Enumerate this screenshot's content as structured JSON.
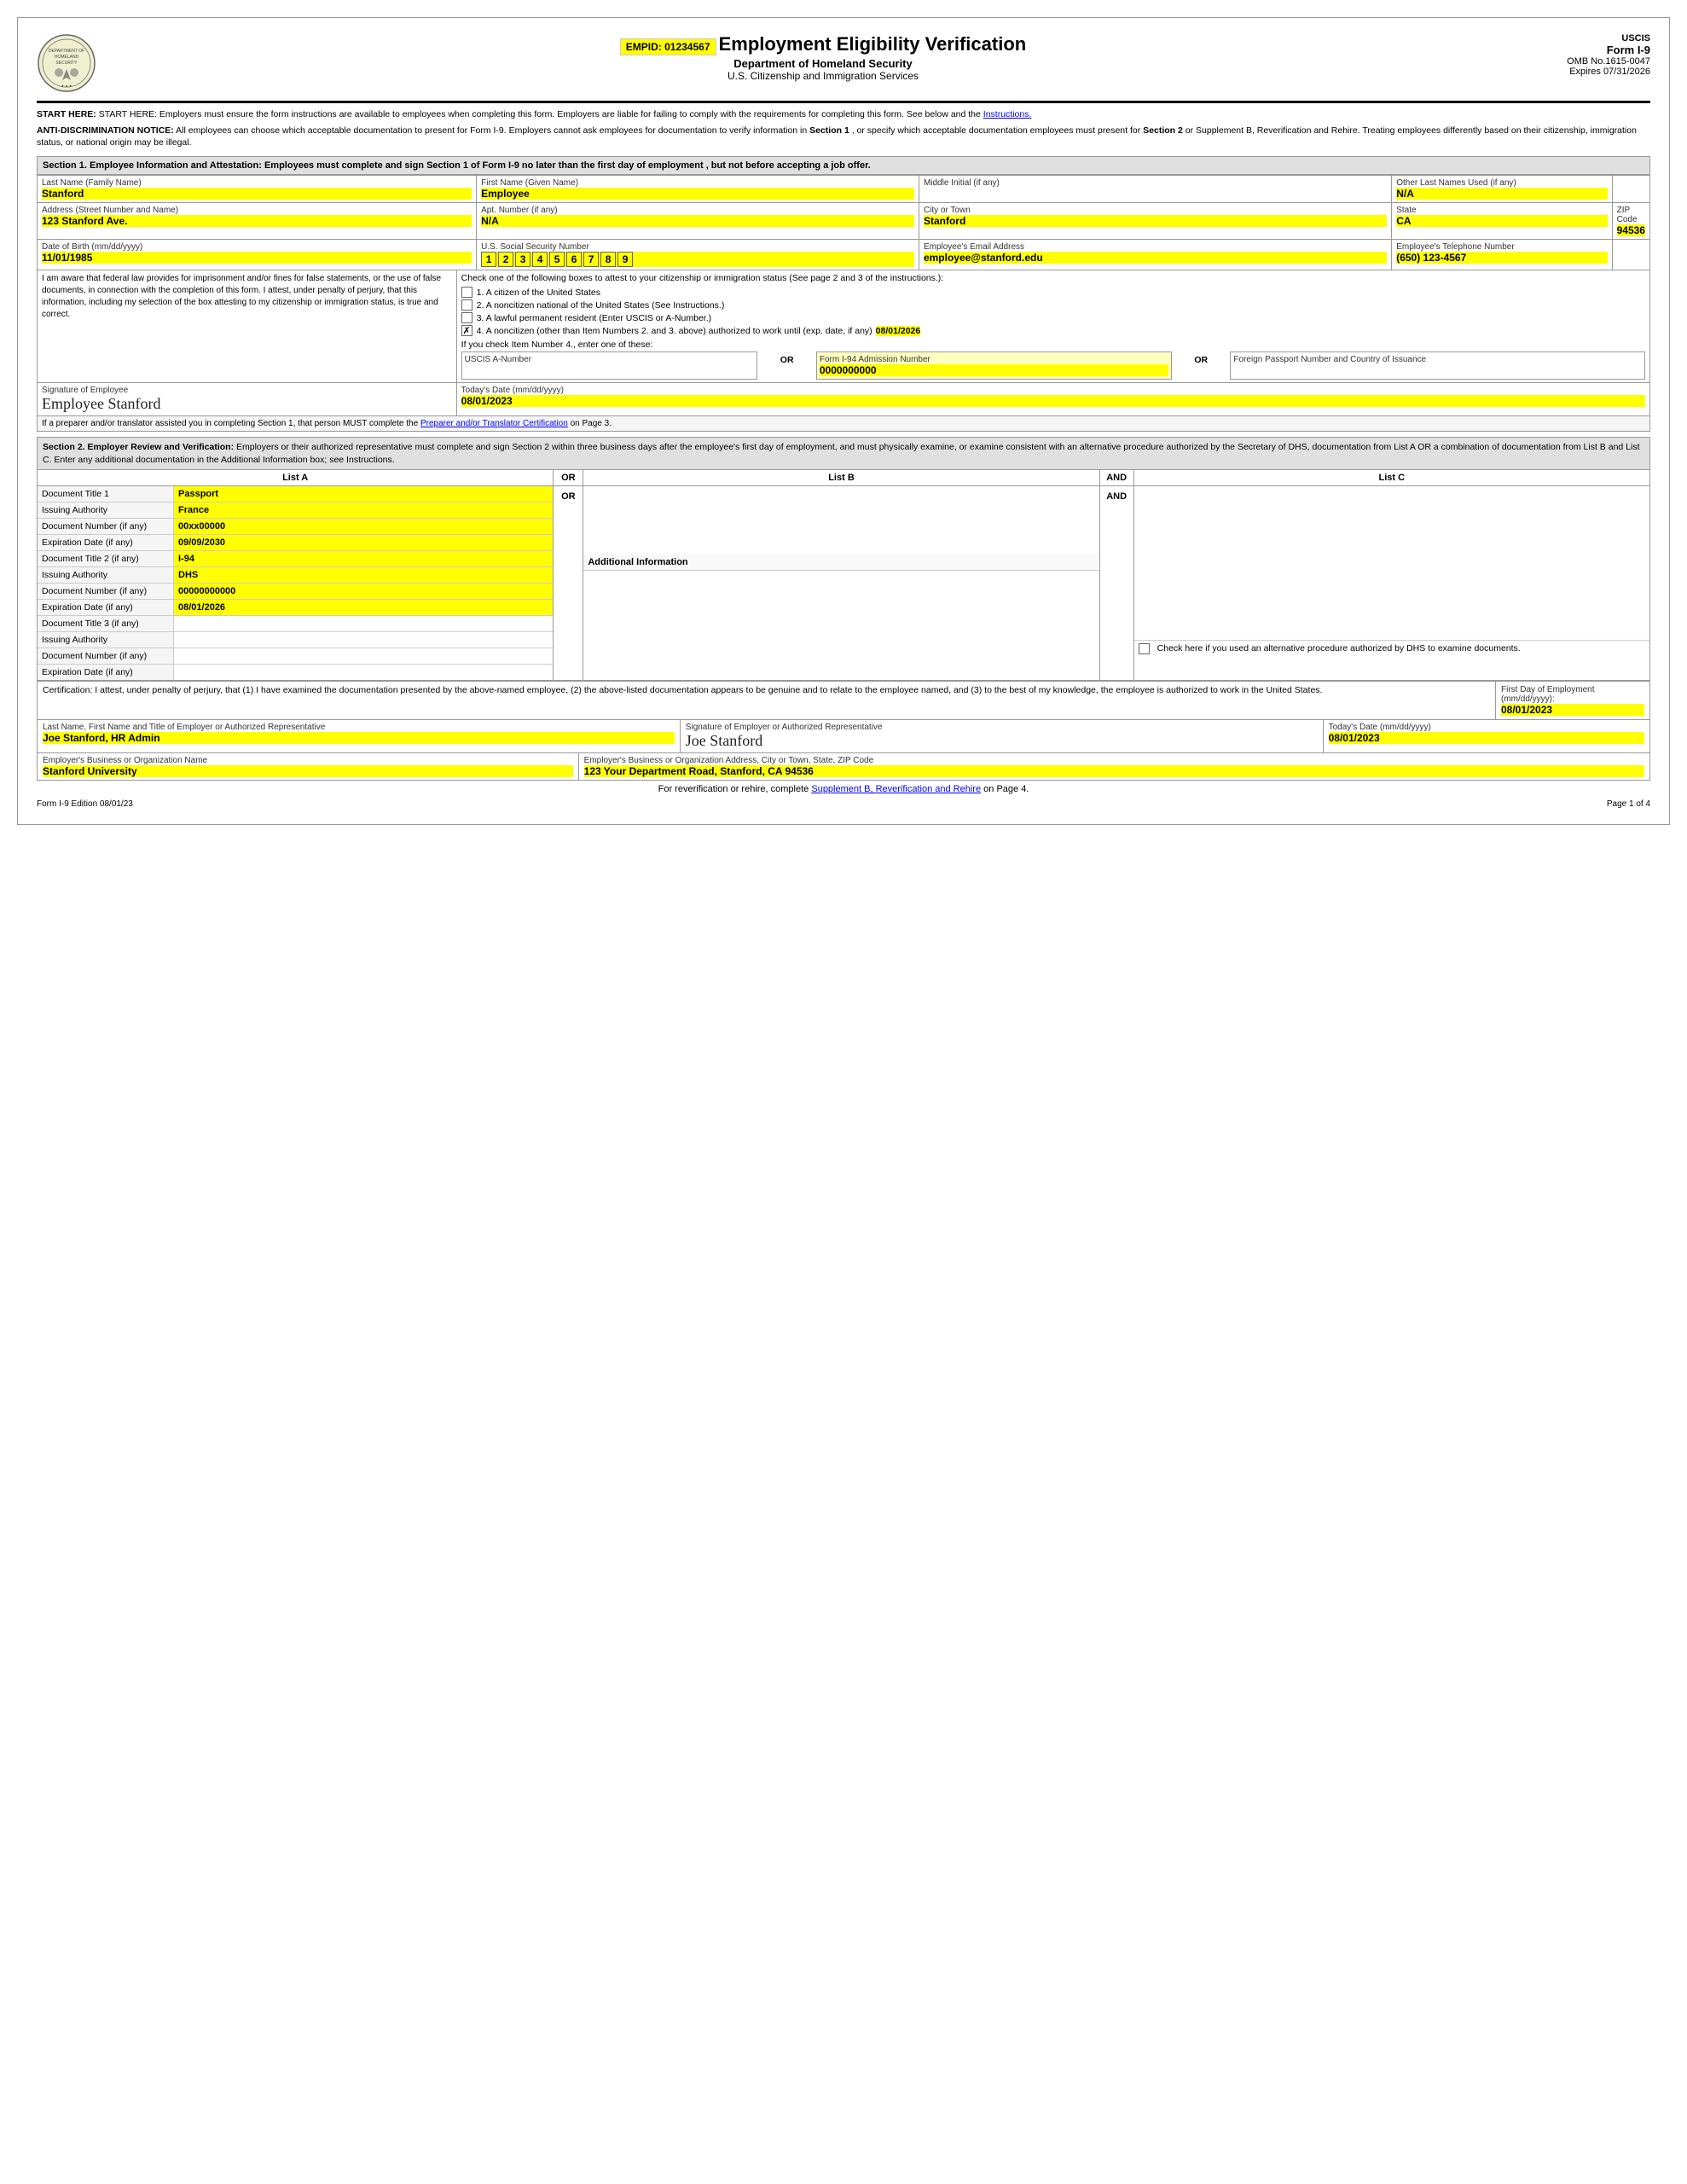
{
  "header": {
    "empid_label": "EMPID: 01234567",
    "title": "Employment Eligibility Verification",
    "dept": "Department of Homeland Security",
    "agency": "U.S. Citizenship and Immigration Services",
    "form_name": "USCIS",
    "form_id": "Form I-9",
    "omb": "OMB No.1615-0047",
    "expires": "Expires 07/31/2026"
  },
  "notices": {
    "start_here": "START HERE:  Employers must ensure the form instructions are available to employees when completing this form. Employers are liable for failing to comply with the requirements for completing this form. See below and the",
    "instructions_link": "Instructions.",
    "anti_disc": "ANTI-DISCRIMINATION NOTICE:",
    "anti_disc_body": " All employees can choose which acceptable documentation to present for Form I-9. Employers cannot ask employees for documentation to verify information in ",
    "section1_bold": "Section 1",
    "anti_disc_body2": ", or specify which acceptable documentation employees must present for ",
    "section2_bold": "Section 2",
    "anti_disc_body3": " or Supplement B, Reverification and Rehire. Treating employees differently based on their citizenship, immigration status, or national origin may be illegal."
  },
  "section1": {
    "header": "Section 1. Employee Information and Attestation:",
    "header_body": " Employees must complete and sign Section 1 of Form I-9 no later than the ",
    "header_bold": "first day of employment",
    "header_body2": ", but not before accepting a job offer.",
    "last_name_label": "Last Name (Family Name)",
    "last_name": "Stanford",
    "first_name_label": "First Name (Given Name)",
    "first_name": "Employee",
    "middle_initial_label": "Middle Initial (if any)",
    "middle_initial": "",
    "other_names_label": "Other Last Names Used (if any)",
    "other_names": "N/A",
    "address_label": "Address (Street Number and Name)",
    "address": "123 Stanford Ave.",
    "apt_label": "Apt. Number (if any)",
    "apt": "N/A",
    "city_label": "City or Town",
    "city": "Stanford",
    "state_label": "State",
    "state": "CA",
    "zip_label": "ZIP Code",
    "zip": "94536",
    "dob_label": "Date of Birth (mm/dd/yyyy)",
    "dob": "11/01/1985",
    "ssn_label": "U.S. Social Security Number",
    "ssn_digits": [
      "1",
      "2",
      "3",
      "4",
      "5",
      "6",
      "7",
      "8",
      "9"
    ],
    "email_label": "Employee's Email Address",
    "email": "employee@stanford.edu",
    "phone_label": "Employee's Telephone Number",
    "phone": "(650) 123-4567",
    "attestation_left": "I am aware that federal law provides for imprisonment and/or fines for false statements, or the use of false documents, in connection with the completion of this form. I attest, under penalty of perjury, that this information, including my selection of the box attesting to my citizenship or immigration status, is true and correct.",
    "checkbox1": "1.  A citizen of the United States",
    "checkbox2": "2.  A noncitizen national of the United States (See Instructions.)",
    "checkbox3": "3.  A lawful permanent resident (Enter USCIS or A-Number.)",
    "checkbox4": "4.  A noncitizen (other than Item Numbers 2. and 3. above) authorized to work until (exp. date, if any)",
    "checkbox4_date": "08/01/2026",
    "checkbox4_checked": true,
    "if_check4_label": "If you check Item Number 4., enter one of these:",
    "uscis_label": "USCIS A-Number",
    "or1": "OR",
    "form94_label": "Form I-94 Admission Number",
    "form94_value": "0000000000",
    "or2": "OR",
    "passport_label": "Foreign Passport Number and Country of Issuance",
    "sig_label": "Signature of Employee",
    "sig_value": "Employee Stanford",
    "date_label": "Today's Date (mm/dd/yyyy)",
    "date_value": "08/01/2023",
    "preparer_note": "If a preparer and/or translator assisted you in completing Section 1, that person MUST complete the",
    "preparer_link": "Preparer and/or Translator Certification",
    "preparer_note2": "on Page 3."
  },
  "section2": {
    "header": "Section 2. Employer Review and Verification:",
    "header_body": " Employers or their authorized representative must complete and sign Section 2 within three business days after the employee's first day of employment, and must physically examine, or examine consistent with an alternative procedure authorized by the Secretary of DHS, documentation from List A OR a combination of documentation from List B and List C. Enter any additional documentation in the Additional Information box; see Instructions.",
    "list_a_label": "List A",
    "list_b_label": "List B",
    "list_c_label": "List C",
    "or_label": "OR",
    "and_label": "AND",
    "doc1_title_label": "Document Title 1",
    "doc1_title": "Passport",
    "doc1_issuing_label": "Issuing Authority",
    "doc1_issuing": "France",
    "doc1_number_label": "Document Number (if any)",
    "doc1_number": "00xx00000",
    "doc1_expiry_label": "Expiration Date (if any)",
    "doc1_expiry": "09/09/2030",
    "doc2_title_label": "Document Title 2 (if any)",
    "doc2_title": "I-94",
    "doc2_issuing_label": "Issuing Authority",
    "doc2_issuing": "DHS",
    "doc2_number_label": "Document Number (if any)",
    "doc2_number": "00000000000",
    "doc2_expiry_label": "Expiration Date (if any)",
    "doc2_expiry": "08/01/2026",
    "doc3_title_label": "Document Title 3 (if any)",
    "doc3_title": "",
    "doc3_issuing_label": "Issuing Authority",
    "doc3_issuing": "",
    "doc3_number_label": "Document Number (if any)",
    "doc3_number": "",
    "doc3_expiry_label": "Expiration Date (if any)",
    "doc3_expiry": "",
    "additional_info_label": "Additional Information",
    "alt_procedure_label": "Check here if you used an alternative procedure authorized by DHS to examine documents.",
    "cert_text": "Certification: I attest, under penalty of perjury, that (1) I have examined the documentation presented by the above-named employee, (2) the above-listed documentation appears to be genuine and to relate to the employee named, and (3) to the best of my knowledge, the employee is authorized to work in the United States.",
    "first_day_label": "First Day of Employment (mm/dd/yyyy):",
    "first_day": "08/01/2023",
    "employer_name_label": "Last Name, First Name and Title of Employer or Authorized Representative",
    "employer_name": "Joe Stanford, HR Admin",
    "sig_label": "Signature of Employer or Authorized Representative",
    "sig_value": "Joe Stanford",
    "today_date_label": "Today's Date (mm/dd/yyyy)",
    "today_date": "08/01/2023",
    "org_name_label": "Employer's Business or Organization Name",
    "org_name": "Stanford University",
    "org_address_label": "Employer's Business or Organization Address, City or Town, State, ZIP Code",
    "org_address": "123 Your Department Road, Stanford, CA 94536"
  },
  "bottom": {
    "rehire_note": "For reverification or rehire, complete",
    "rehire_link": "Supplement B, Reverification and Rehire",
    "rehire_note2": "on Page 4.",
    "form_edition": "Form I-9  Edition  08/01/23",
    "page": "Page 1 of 4"
  }
}
